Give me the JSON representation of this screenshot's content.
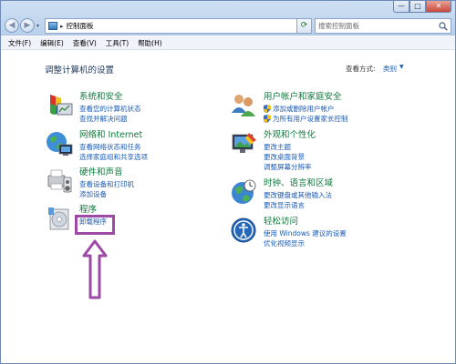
{
  "window": {
    "caption_buttons": {
      "minimize": "—",
      "maximize": "□",
      "close": "✕"
    }
  },
  "navigation": {
    "back_glyph": "◀",
    "forward_glyph": "▶",
    "address_separator": "▸",
    "address_text": "控制面板",
    "refresh_glyph": "⟳"
  },
  "search": {
    "placeholder": "搜索控制面板"
  },
  "menubar": {
    "items": [
      "文件(F)",
      "编辑(E)",
      "查看(V)",
      "工具(T)",
      "帮助(H)"
    ]
  },
  "page": {
    "title": "调整计算机的设置",
    "view_by_label": "查看方式:",
    "view_by_value": "类别"
  },
  "categories": [
    {
      "title": "系统和安全",
      "links": [
        "查看您的计算机状态",
        "查找并解决问题"
      ],
      "icon": "system-security-icon"
    },
    {
      "title": "网络和 Internet",
      "links": [
        "查看网络状态和任务",
        "选择家庭组和共享选项"
      ],
      "icon": "network-internet-icon"
    },
    {
      "title": "硬件和声音",
      "links": [
        "查看设备和打印机",
        "添加设备"
      ],
      "icon": "hardware-sound-icon"
    },
    {
      "title": "程序",
      "links": [
        "卸载程序"
      ],
      "icon": "programs-icon"
    },
    {
      "title": "用户帐户和家庭安全",
      "links": [
        "添加或删除用户帐户",
        "为所有用户设置家长控制"
      ],
      "icon": "user-accounts-icon"
    },
    {
      "title": "外观和个性化",
      "links": [
        "更改主题",
        "更改桌面背景",
        "调整屏幕分辨率"
      ],
      "icon": "appearance-icon"
    },
    {
      "title": "时钟、语言和区域",
      "links": [
        "更改键盘或其他输入法",
        "更改显示语言"
      ],
      "icon": "clock-language-icon"
    },
    {
      "title": "轻松访问",
      "links": [
        "使用 Windows 建议的设置",
        "优化视频显示"
      ],
      "icon": "ease-of-access-icon"
    }
  ],
  "colors": {
    "link": "#1a5bb5",
    "category_title": "#0d7a3c",
    "annotation": "#9d4aa6"
  }
}
